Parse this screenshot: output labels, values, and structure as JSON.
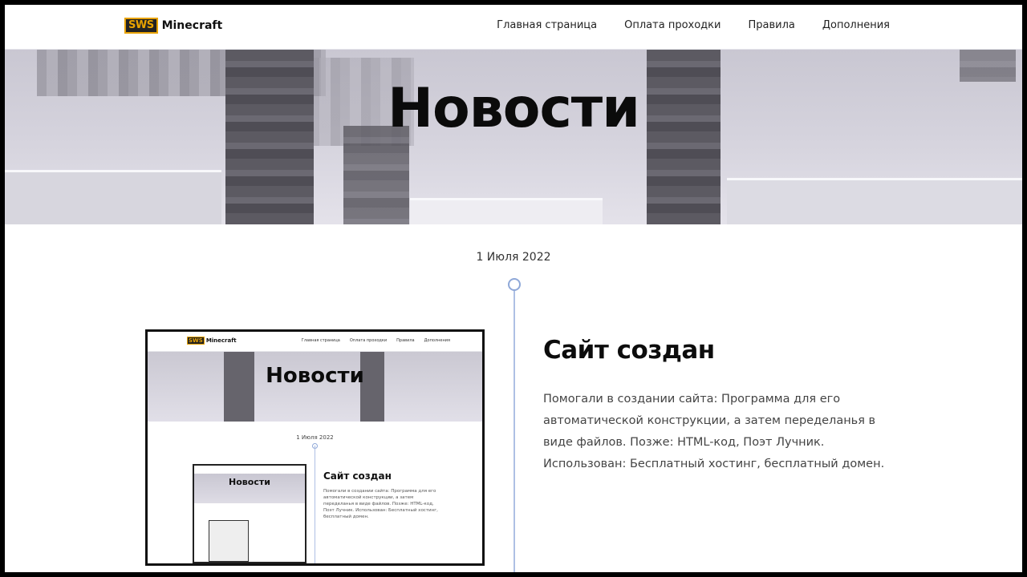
{
  "header": {
    "logo_badge": "SWS",
    "logo_text": "Minecraft",
    "nav": [
      "Главная страница",
      "Оплата проходки",
      "Правила",
      "Дополнения"
    ]
  },
  "hero": {
    "title": "Новости"
  },
  "timeline": {
    "date": "1 Июля 2022",
    "article": {
      "title": "Сайт создан",
      "body": "Помогали в создании сайта: Программа для его автоматической конструкции, а затем переделанья в виде файлов. Позже: HTML-код, Поэт Лучник. Использован: Бесплатный хостинг, бесплатный домен."
    }
  },
  "screenshot_preview": {
    "logo_badge": "SWS",
    "logo_text": "Minecraft",
    "nav": [
      "Главная страница",
      "Оплата проходки",
      "Правила",
      "Дополнения"
    ],
    "hero_title": "Новости",
    "date": "1 Июля 2022",
    "article_title": "Сайт создан",
    "article_body": "Помогали в создании сайта: Программа для его автоматической конструкции, а затем переделанья в виде файлов. Позже: HTML-код, Поэт Лучник. Использован: Бесплатный хостинг, бесплатный домен.",
    "nested_hero_title": "Новости"
  },
  "colors": {
    "accent": "#e8a200",
    "timeline": "#aec0e4",
    "text_dark": "#0c0c0c"
  }
}
